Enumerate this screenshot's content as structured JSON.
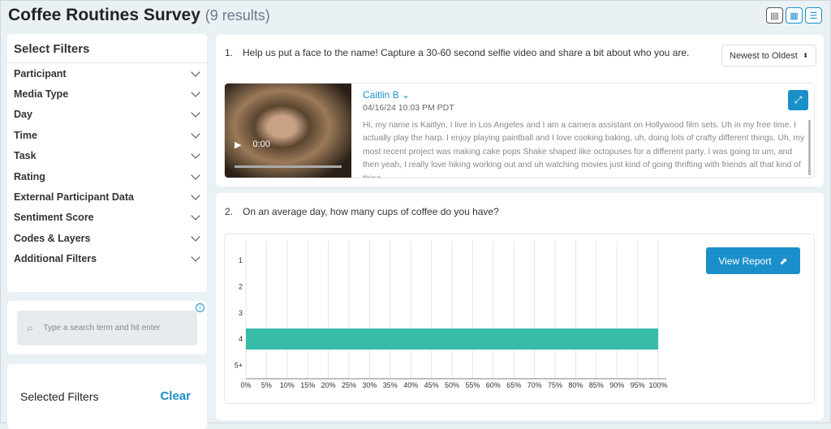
{
  "header": {
    "title": "Coffee Routines Survey",
    "count": "(9 results)",
    "view_icons": [
      "table-icon",
      "grid-icon",
      "list-icon"
    ]
  },
  "filters": {
    "title": "Select Filters",
    "items": [
      "Participant",
      "Media Type",
      "Day",
      "Time",
      "Task",
      "Rating",
      "External Participant Data",
      "Sentiment Score",
      "Codes & Layers",
      "Additional Filters"
    ]
  },
  "search": {
    "placeholder": "Type a search term and hit enter"
  },
  "selected": {
    "label": "Selected Filters",
    "clear": "Clear"
  },
  "q1": {
    "number": "1.",
    "text": "Help us put a face to the name! Capture a 30-60 second selfie video and share a bit about who you are.",
    "sort": "Newest to Oldest",
    "response": {
      "name": "Caitlin B",
      "date": "04/16/24 10:03 PM PDT",
      "time": "0:00",
      "transcript": "Hi, my name is Kaitlyn. I live in Los Angeles and I am a camera assistant on Hollywood film sets. Uh in my free time. I actually play the harp. I enjoy playing paintball and I love cooking baking, uh, doing lots of crafty different things. Uh, my most recent project was making cake pops Shake shaped like octopuses for a different party. I was going to um, and then yeah, I really love hiking working out and uh watching movies just kind of going thrifting with friends all that kind of thing."
    }
  },
  "q2": {
    "number": "2.",
    "text": "On an average day, how many cups of coffee do you have?",
    "view_report": "View Report"
  },
  "colors": {
    "accent": "#1a8fc9",
    "bar": "#37bca9"
  },
  "chart_data": {
    "type": "bar",
    "orientation": "horizontal",
    "categories": [
      "1",
      "2",
      "3",
      "4",
      "5+"
    ],
    "values": [
      0,
      0,
      0,
      100,
      0
    ],
    "xlim": [
      0,
      100
    ],
    "xticks": [
      "0%",
      "5%",
      "10%",
      "15%",
      "20%",
      "25%",
      "30%",
      "35%",
      "40%",
      "45%",
      "50%",
      "55%",
      "60%",
      "65%",
      "70%",
      "75%",
      "80%",
      "85%",
      "90%",
      "95%",
      "100%"
    ],
    "grid": true
  }
}
